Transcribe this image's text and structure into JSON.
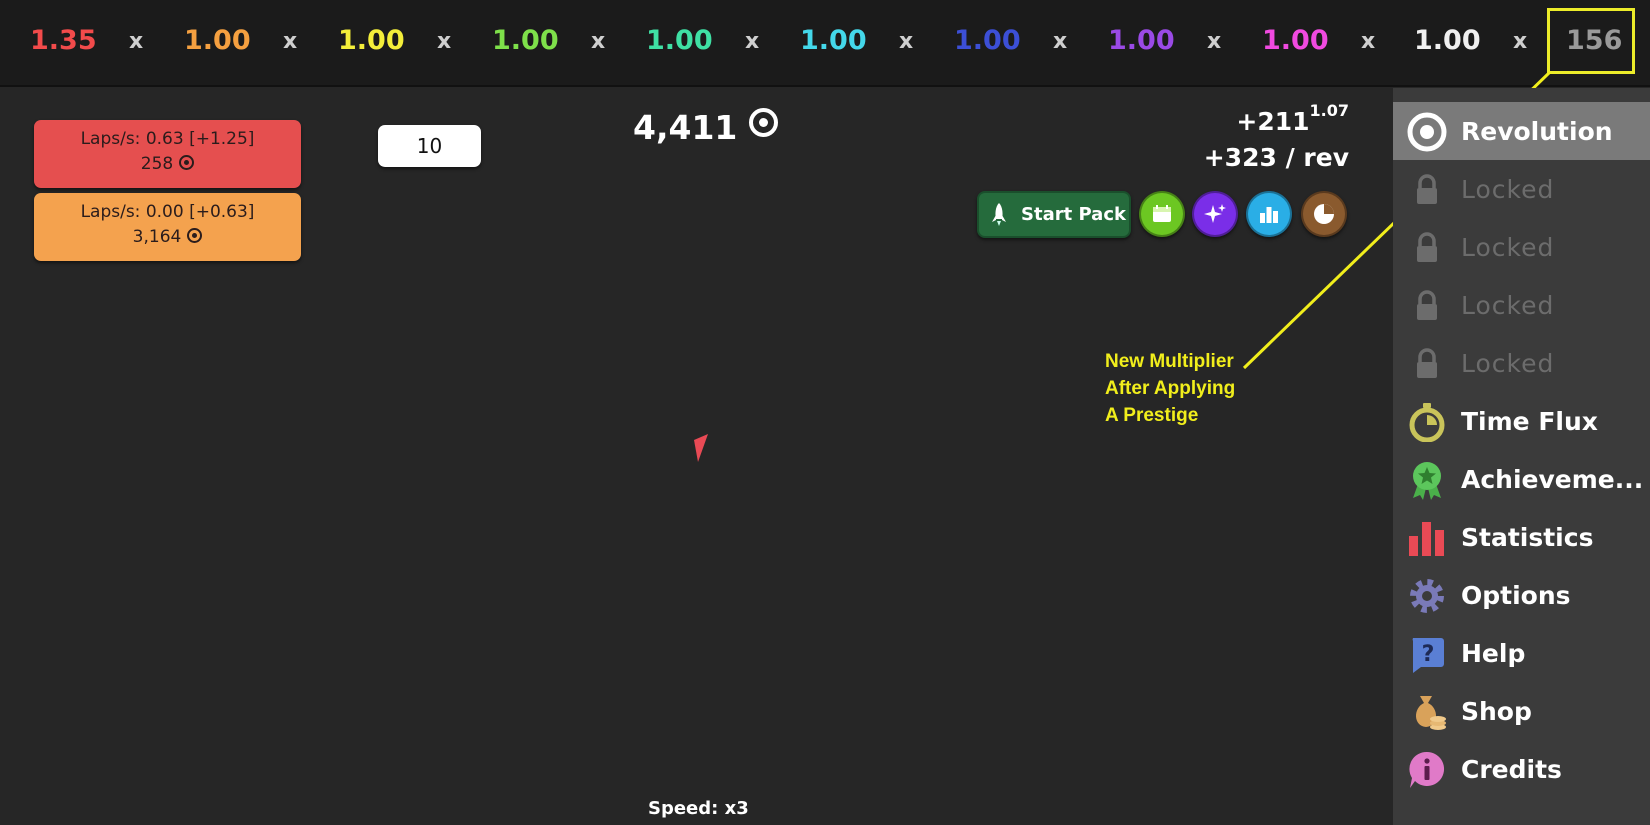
{
  "multipliers": [
    {
      "value": "1.35",
      "color": "#f24b4b"
    },
    {
      "value": "1.00",
      "color": "#f5a040"
    },
    {
      "value": "1.00",
      "color": "#f3ee3a"
    },
    {
      "value": "1.00",
      "color": "#7ee04a"
    },
    {
      "value": "1.00",
      "color": "#3fe0a4"
    },
    {
      "value": "1.00",
      "color": "#44d8ea"
    },
    {
      "value": "1.00",
      "color": "#3c4fd6"
    },
    {
      "value": "1.00",
      "color": "#9a4ae6"
    },
    {
      "value": "1.00",
      "color": "#f04ae0"
    },
    {
      "value": "1.00",
      "color": "#f0f0f0"
    }
  ],
  "times_symbol": "x",
  "prestige_multiplier": "156",
  "upgrades": [
    {
      "laps": "Laps/s: 0.63 [+1.25]",
      "cost": "258",
      "color": "#e54f4f"
    },
    {
      "laps": "Laps/s: 0.00 [+0.63]",
      "cost": "3,164",
      "color": "#f4a24e"
    }
  ],
  "buy_quantity": "10",
  "money": "4,411",
  "gain": {
    "base": "+211",
    "exponent": "1.07",
    "per_rev": "+323 / rev"
  },
  "actions": {
    "start_pack_label": "Start Pack",
    "buttons": [
      {
        "name": "calendar-button",
        "icon": "calendar-icon",
        "color": "#6cc722"
      },
      {
        "name": "sparkle-button",
        "icon": "sparkle-icon",
        "color": "#7a2ee8"
      },
      {
        "name": "leaderboard-button",
        "icon": "bar-chart-icon",
        "color": "#2aaee6"
      },
      {
        "name": "pie-button",
        "icon": "pie-chart-icon",
        "color": "#8a5a2e"
      }
    ]
  },
  "annotation": {
    "line1": "New Multiplier",
    "line2": "After Applying",
    "line3": "A Prestige",
    "color": "#f1ee1c"
  },
  "speed": "Speed: x3",
  "sidebar": {
    "items": [
      {
        "label": "Revolution",
        "icon": "target-icon",
        "active": true
      },
      {
        "label": "Locked",
        "icon": "lock-icon",
        "locked": true
      },
      {
        "label": "Locked",
        "icon": "lock-icon",
        "locked": true
      },
      {
        "label": "Locked",
        "icon": "lock-icon",
        "locked": true
      },
      {
        "label": "Locked",
        "icon": "lock-icon",
        "locked": true
      },
      {
        "label": "Time Flux",
        "icon": "stopwatch-icon"
      },
      {
        "label": "Achieveme...",
        "icon": "award-icon"
      },
      {
        "label": "Statistics",
        "icon": "bar-chart-icon"
      },
      {
        "label": "Options",
        "icon": "gear-icon"
      },
      {
        "label": "Help",
        "icon": "help-icon"
      },
      {
        "label": "Shop",
        "icon": "money-bag-icon"
      },
      {
        "label": "Credits",
        "icon": "info-icon"
      }
    ]
  }
}
